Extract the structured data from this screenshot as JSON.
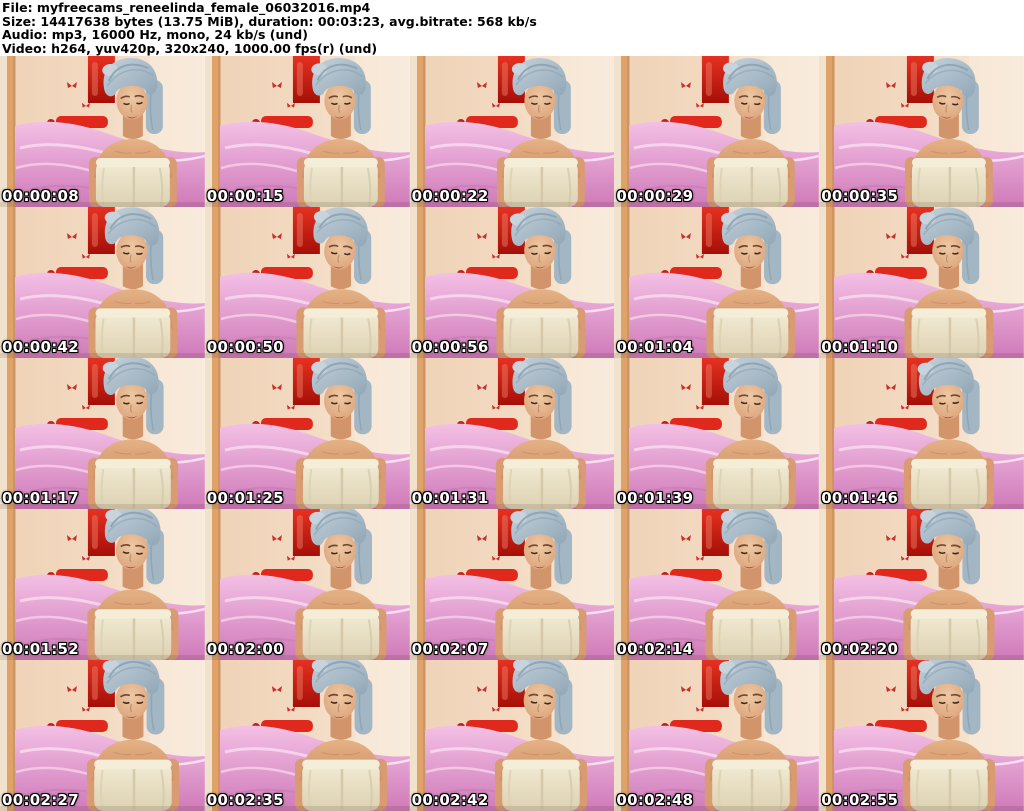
{
  "header": {
    "file_line": "File: myfreecams_reneelinda_female_06032016.mp4",
    "size_line": "Size: 14417638 bytes (13.75 MiB), duration: 00:03:23, avg.bitrate: 568 kb/s",
    "audio_line": "Audio: mp3, 16000 Hz, mono, 24 kb/s (und)",
    "video_line": "Video: h264, yuv420p, 320x240, 1000.00 fps(r) (und)"
  },
  "grid": {
    "columns": 5,
    "rows": 5,
    "timestamps": [
      "00:00:08",
      "00:00:15",
      "00:00:22",
      "00:00:29",
      "00:00:35",
      "00:00:42",
      "00:00:50",
      "00:00:56",
      "00:01:04",
      "00:01:10",
      "00:01:17",
      "00:01:25",
      "00:01:31",
      "00:01:39",
      "00:01:46",
      "00:01:52",
      "00:02:00",
      "00:02:07",
      "00:02:14",
      "00:02:20",
      "00:02:27",
      "00:02:35",
      "00:02:42",
      "00:02:48",
      "00:02:55"
    ]
  },
  "scene": {
    "description": "Webcam room frames: woman with grey-blue towel turban wrapped in a cream towel, pink satin bed, red roses in vase, red wall panel, warm beige walls",
    "colors": {
      "header_bg": "#ffffff",
      "header_text": "#000000",
      "timestamp_text": "#ffffff",
      "timestamp_outline": "#000000",
      "wall_warm": "#f0d5ba",
      "wall_light": "#f8ead9",
      "door_orange": "#dfa269",
      "red_panel": "#cc1a10",
      "headboard_red": "#e0281c",
      "bed_pink": "#e5a0d0",
      "bed_highlight": "#f8d7ee",
      "rose_red": "#c22020",
      "leaf_green": "#41662d",
      "turban_grey_blue": "#a7bac7",
      "towel_cream": "#ece3c8",
      "skin_tone": "#d89b72"
    }
  }
}
